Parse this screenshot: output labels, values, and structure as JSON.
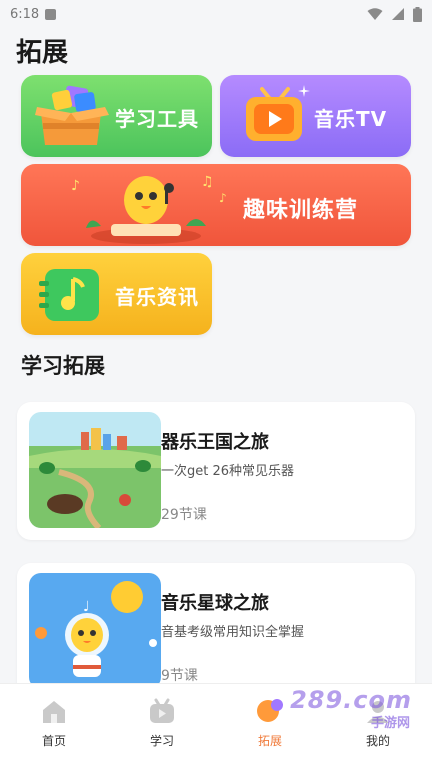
{
  "status_bar": {
    "time": "6:18"
  },
  "page": {
    "title": "拓展"
  },
  "cards": {
    "tools": "学习工具",
    "tv": "音乐TV",
    "camp": "趣味训练营",
    "news": "音乐资讯"
  },
  "section": {
    "title": "学习拓展"
  },
  "courses": [
    {
      "title": "器乐王国之旅",
      "desc": "一次get 26种常见乐器",
      "lessons": "29节课"
    },
    {
      "title": "音乐星球之旅",
      "desc": "音基考级常用知识全掌握",
      "lessons": "9节课"
    }
  ],
  "nav": [
    {
      "label": "首页",
      "icon": "home-icon"
    },
    {
      "label": "学习",
      "icon": "study-icon"
    },
    {
      "label": "拓展",
      "icon": "expand-icon",
      "active": true
    },
    {
      "label": "我的",
      "icon": "profile-icon"
    }
  ],
  "watermark": {
    "main": "289.com",
    "sub": "手游网"
  },
  "colors": {
    "active": "#f07a3a",
    "green": "#4cc45c",
    "purple": "#8b6cf6",
    "red": "#f0553b",
    "yellow": "#f5b21d"
  }
}
